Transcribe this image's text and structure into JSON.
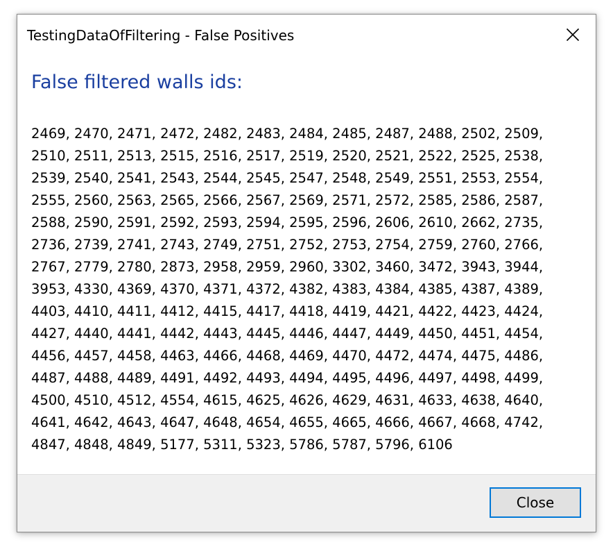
{
  "window": {
    "title": "TestingDataOfFiltering - False Positives"
  },
  "icons": {
    "close": "close-icon"
  },
  "content": {
    "heading": "False filtered walls ids:",
    "ids": "2469, 2470, 2471, 2472, 2482, 2483, 2484, 2485, 2487, 2488, 2502, 2509, 2510, 2511, 2513, 2515, 2516, 2517, 2519, 2520, 2521, 2522, 2525, 2538, 2539, 2540, 2541, 2543, 2544, 2545, 2547, 2548, 2549, 2551, 2553, 2554, 2555, 2560, 2563, 2565, 2566, 2567, 2569, 2571, 2572, 2585, 2586, 2587, 2588, 2590, 2591, 2592, 2593, 2594, 2595, 2596, 2606, 2610, 2662, 2735, 2736, 2739, 2741, 2743, 2749, 2751, 2752, 2753, 2754, 2759, 2760, 2766, 2767, 2779, 2780, 2873, 2958, 2959, 2960, 3302, 3460, 3472, 3943, 3944, 3953, 4330, 4369, 4370, 4371, 4372, 4382, 4383, 4384, 4385, 4387, 4389, 4403, 4410, 4411, 4412, 4415, 4417, 4418, 4419, 4421, 4422, 4423, 4424, 4427, 4440, 4441, 4442, 4443, 4445, 4446, 4447, 4449, 4450, 4451, 4454, 4456, 4457, 4458, 4463, 4466, 4468, 4469, 4470, 4472, 4474, 4475, 4486, 4487, 4488, 4489, 4491, 4492, 4493, 4494, 4495, 4496, 4497, 4498, 4499, 4500, 4510, 4512, 4554, 4615, 4625, 4626, 4629, 4631, 4633, 4638, 4640, 4641, 4642, 4643, 4647, 4648, 4654, 4655, 4665, 4666, 4667, 4668, 4742, 4847, 4848, 4849, 5177, 5311, 5323, 5786, 5787, 5796, 6106"
  },
  "footer": {
    "close_label": "Close"
  },
  "colors": {
    "heading": "#1a3fa0",
    "button_border": "#0078d7",
    "footer_bg": "#f0f0f0"
  }
}
